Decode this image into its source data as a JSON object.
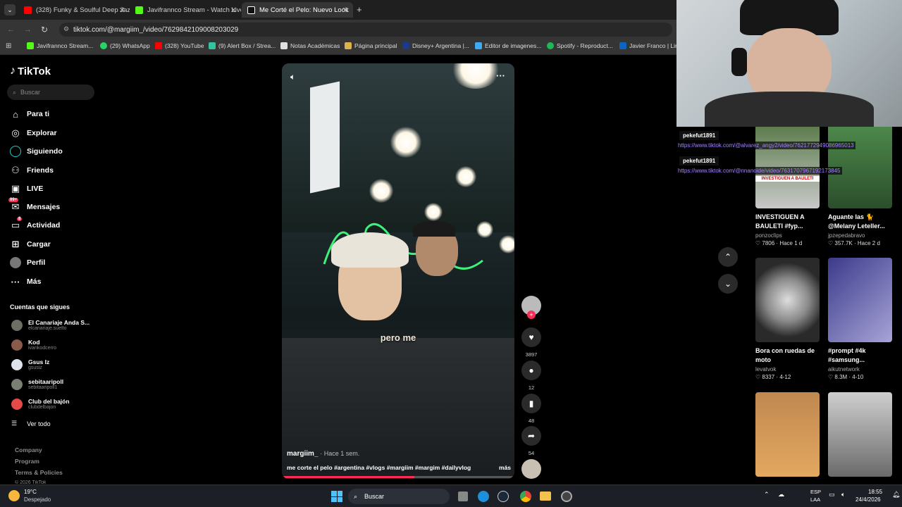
{
  "browser": {
    "tabs": [
      {
        "label": "(328) Funky & Soulful Deep Jazz",
        "color": "#ff0000"
      },
      {
        "label": "Javifrannco Stream - Watch Live",
        "color": "#53fc18"
      },
      {
        "label": "Me Corté el Pelo: Nuevo Look",
        "color": "#ffffff"
      }
    ],
    "url": "tiktok.com/@margiim_/video/7629842109008203029",
    "bookmarks": [
      {
        "label": "Javifrannco Stream...",
        "color": "#53fc18"
      },
      {
        "label": "(29) WhatsApp",
        "color": "#25d366"
      },
      {
        "label": "(328) YouTube",
        "color": "#ff0000"
      },
      {
        "label": "(9) Alert Box / Strea...",
        "color": "#31c3a2"
      },
      {
        "label": "Notas Académicas",
        "color": "#e0e0e0"
      },
      {
        "label": "Página principal",
        "color": "#d9b44a"
      },
      {
        "label": "Disney+ Argentina |...",
        "color": "#1a3a8a"
      },
      {
        "label": "Editor de imagenes...",
        "color": "#3fa9f5"
      },
      {
        "label": "Spotify - Reproduct...",
        "color": "#1db954"
      },
      {
        "label": "Javier Franco | Link...",
        "color": "#0a66c2"
      }
    ]
  },
  "sidebar": {
    "logo": "TikTok",
    "search_placeholder": "Buscar",
    "nav": [
      {
        "label": "Para ti",
        "icon": "home-icon"
      },
      {
        "label": "Explorar",
        "icon": "compass-icon"
      },
      {
        "label": "Siguiendo",
        "icon": "following-icon"
      },
      {
        "label": "Friends",
        "icon": "friends-icon"
      },
      {
        "label": "LIVE",
        "icon": "live-icon"
      },
      {
        "label": "Mensajes",
        "icon": "messages-icon",
        "badge": "99+"
      },
      {
        "label": "Actividad",
        "icon": "activity-icon",
        "badge": "8"
      },
      {
        "label": "Cargar",
        "icon": "upload-icon"
      },
      {
        "label": "Perfil",
        "icon": "profile-icon"
      },
      {
        "label": "Más",
        "icon": "more-icon"
      }
    ],
    "follows_title": "Cuentas que sigues",
    "accounts": [
      {
        "name": "El Canariaje Anda S...",
        "handle": "elcanariaje.suelto"
      },
      {
        "name": "Kod",
        "handle": "ivankodcerro"
      },
      {
        "name": "Gsus Iz",
        "handle": "gsusiz"
      },
      {
        "name": "sebitaaripoll",
        "handle": "sebitaaripoll1"
      },
      {
        "name": "Club del bajón",
        "handle": "clubdelbajon"
      }
    ],
    "see_all": "Ver todo",
    "footer": [
      "Company",
      "Program",
      "Terms & Policies",
      "© 2026 TikTok"
    ]
  },
  "video": {
    "caption": "pero me",
    "author": "margiim_",
    "time": "· Hace 1 sem.",
    "description": "me corte el pelo #argentina #vlogs #margiim #margim #dailyvlog",
    "more": "más",
    "progress": 0.57
  },
  "actions": {
    "likes": "3897",
    "comments": "12",
    "saves": "48",
    "shares": "54"
  },
  "related": [
    {
      "title": "INVESTIGUEN A BAULETI #fyp...",
      "user": "ponzoclips",
      "stats": "7806 · Hace 1 d",
      "overlay": "INVESTIGUEN A BAULETI"
    },
    {
      "title": "Aguante las 🐈 @Melany Leteller...",
      "user": "jpzepedabravo",
      "stats": "357.7K · Hace 2 d"
    },
    {
      "title": "Bora con ruedas de moto",
      "user": "levatvok",
      "stats": "8337 · 4-12"
    },
    {
      "title": "#prompt #4k #samsung...",
      "user": "aikutnetwork",
      "stats": "8.3M · 4-10"
    }
  ],
  "stream_chat": [
    {
      "user": "pekefut1891",
      "link": "https://www.tiktok.com/@alvarez_angy2/video/7621772949086965013"
    },
    {
      "user": "pekefut1891",
      "link": "https://www.tiktok.com/@nnanoide/video/7631707967192173845"
    }
  ],
  "taskbar": {
    "temp": "19°C",
    "weather": "Despejado",
    "search": "Buscar",
    "lang": "ESP",
    "layout": "LAA",
    "time": "18:55",
    "date": "24/4/2026"
  }
}
